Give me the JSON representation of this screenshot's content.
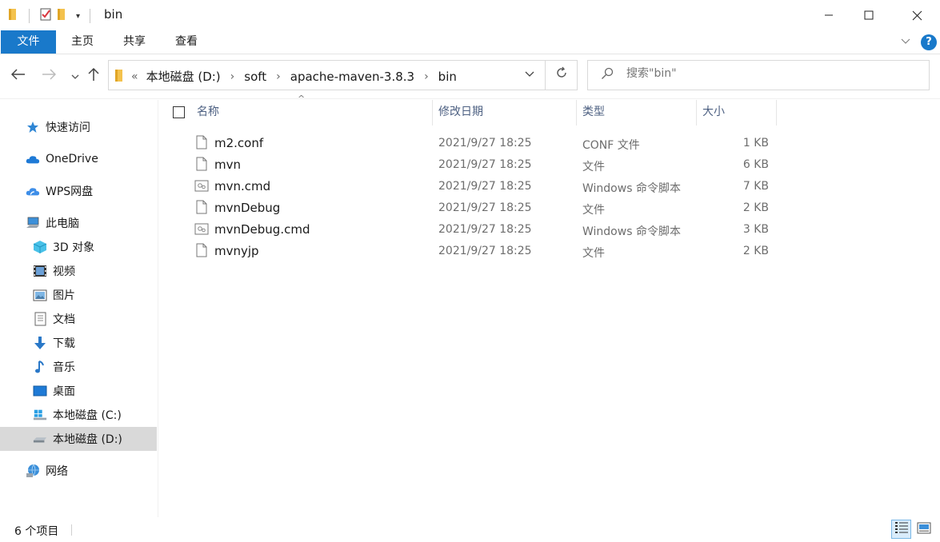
{
  "window": {
    "title": "bin"
  },
  "ribbon": {
    "tabs": [
      "文件",
      "主页",
      "共享",
      "查看"
    ],
    "help": "?"
  },
  "nav": {
    "breadcrumb_prefix": "«",
    "breadcrumb": [
      "本地磁盘 (D:)",
      "soft",
      "apache-maven-3.8.3",
      "bin"
    ],
    "search_placeholder": "搜索\"bin\""
  },
  "sidebar": {
    "items": [
      {
        "label": "快速访问",
        "icon": "star-icon",
        "level": 1
      },
      {
        "label": "OneDrive",
        "icon": "onedrive-cloud-icon",
        "level": 1
      },
      {
        "label": "WPS网盘",
        "icon": "wps-cloud-icon",
        "level": 1
      },
      {
        "label": "此电脑",
        "icon": "computer-icon",
        "level": 1
      },
      {
        "label": "3D 对象",
        "icon": "3d-objects-icon",
        "level": 2
      },
      {
        "label": "视频",
        "icon": "video-icon",
        "level": 2
      },
      {
        "label": "图片",
        "icon": "pictures-icon",
        "level": 2
      },
      {
        "label": "文档",
        "icon": "documents-icon",
        "level": 2
      },
      {
        "label": "下载",
        "icon": "download-icon",
        "level": 2
      },
      {
        "label": "音乐",
        "icon": "music-icon",
        "level": 2
      },
      {
        "label": "桌面",
        "icon": "desktop-icon",
        "level": 2
      },
      {
        "label": "本地磁盘 (C:)",
        "icon": "windows-drive-icon",
        "level": 2
      },
      {
        "label": "本地磁盘 (D:)",
        "icon": "drive-icon",
        "level": 2,
        "selected": true
      },
      {
        "label": "网络",
        "icon": "network-icon",
        "level": 1
      }
    ]
  },
  "columns": {
    "name": "名称",
    "date": "修改日期",
    "type": "类型",
    "size": "大小"
  },
  "files": [
    {
      "name": "m2.conf",
      "date": "2021/9/27 18:25",
      "type": "CONF 文件",
      "size": "1 KB",
      "icon": "file-icon"
    },
    {
      "name": "mvn",
      "date": "2021/9/27 18:25",
      "type": "文件",
      "size": "6 KB",
      "icon": "file-icon"
    },
    {
      "name": "mvn.cmd",
      "date": "2021/9/27 18:25",
      "type": "Windows 命令脚本",
      "size": "7 KB",
      "icon": "script-file-icon"
    },
    {
      "name": "mvnDebug",
      "date": "2021/9/27 18:25",
      "type": "文件",
      "size": "2 KB",
      "icon": "file-icon"
    },
    {
      "name": "mvnDebug.cmd",
      "date": "2021/9/27 18:25",
      "type": "Windows 命令脚本",
      "size": "3 KB",
      "icon": "script-file-icon"
    },
    {
      "name": "mvnyjp",
      "date": "2021/9/27 18:25",
      "type": "文件",
      "size": "2 KB",
      "icon": "file-icon"
    }
  ],
  "status": {
    "count": "6 个项目"
  },
  "colors": {
    "accent": "#1979ca",
    "selected_nav": "#d9d9d9",
    "header_text": "#4d6082"
  }
}
